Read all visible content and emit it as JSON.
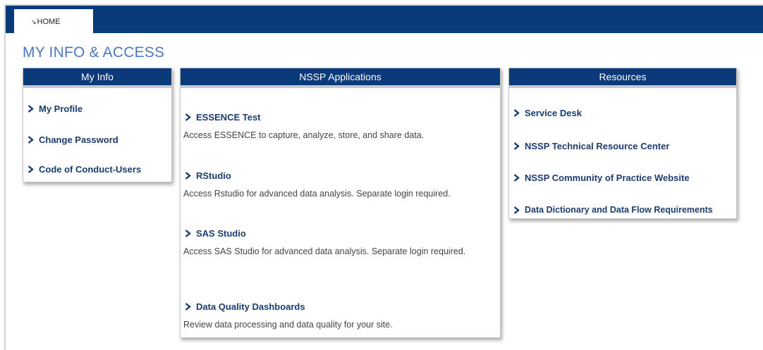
{
  "nav": {
    "home_label": "HOME"
  },
  "page": {
    "title": "MY INFO & ACCESS"
  },
  "my_info": {
    "header": "My Info",
    "links": [
      "My Profile",
      "Change Password",
      "Code of Conduct-Users"
    ]
  },
  "nssp": {
    "header": "NSSP Applications",
    "apps": [
      {
        "title": "ESSENCE Test",
        "desc": "Access ESSENCE to capture, analyze, store, and share data."
      },
      {
        "title": "RStudio",
        "desc": "Access Rstudio for advanced data analysis. Separate login required."
      },
      {
        "title": "SAS Studio",
        "desc": "Access SAS Studio for advanced data analysis. Separate login required."
      },
      {
        "title": "Data Quality Dashboards",
        "desc": "Review data processing and data quality for your site."
      }
    ]
  },
  "resources": {
    "header": "Resources",
    "links": [
      "Service Desk",
      "NSSP Technical Resource Center",
      "NSSP Community of Practice Website",
      "Data Dictionary and Data Flow Requirements"
    ]
  },
  "colors": {
    "nav_bar": "#0b3a7a",
    "title": "#4a78c4",
    "link": "#1b3c6e"
  },
  "icons": {
    "chevron": "chevron-right-icon",
    "home": "home-icon"
  }
}
